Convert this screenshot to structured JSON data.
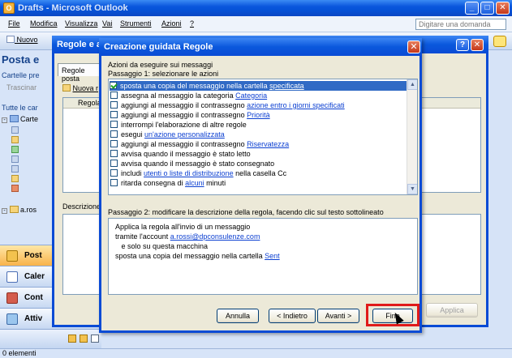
{
  "outlook": {
    "title": "Drafts - Microsoft Outlook",
    "menu": [
      "File",
      "Modifica",
      "Visualizza",
      "Vai",
      "Strumenti",
      "Azioni",
      "?"
    ],
    "help_placeholder": "Digitare una domanda",
    "toolbar_new": "Nuovo",
    "nav_header": "Posta e",
    "cartelle_label": "Cartelle pre",
    "trascina": "Trascinar",
    "tutte_label": "Tutte le car",
    "tree_root": "Carte",
    "tree_account": "a.ros",
    "nav_buttons": [
      {
        "label": "Post",
        "icon": "mail-icon"
      },
      {
        "label": "Caler",
        "icon": "calendar-icon"
      },
      {
        "label": "Cont",
        "icon": "contacts-icon"
      },
      {
        "label": "Attiv",
        "icon": "tasks-icon"
      }
    ],
    "status": "0 elementi"
  },
  "regole": {
    "title": "Regole e av",
    "tab_label": "Regole posta",
    "new_rule_btn": "Nuova r",
    "col_regola": "Regola",
    "desc_label": "Descrizione r",
    "apply_btn": "Applica"
  },
  "wizard": {
    "title": "Creazione guidata Regole",
    "heading": "Azioni da eseguire sui messaggi",
    "step1": "Passaggio 1: selezionare le azioni",
    "actions": [
      {
        "text": "sposta una copia del messaggio nella cartella ",
        "link": "specificata",
        "after": "",
        "checked": true,
        "selected": true
      },
      {
        "text": "assegna al messaggio la categoria ",
        "link": "Categoria",
        "after": "",
        "checked": false,
        "selected": false
      },
      {
        "text": "aggiungi al messaggio il contrassegno ",
        "link": "azione entro i giorni specificati",
        "after": "",
        "checked": false,
        "selected": false
      },
      {
        "text": "aggiungi al messaggio il contrassegno ",
        "link": "Priorità",
        "after": "",
        "checked": false,
        "selected": false
      },
      {
        "text": "interrompi l'elaborazione di altre regole",
        "link": "",
        "after": "",
        "checked": false,
        "selected": false
      },
      {
        "text": "esegui ",
        "link": "un'azione personalizzata",
        "after": "",
        "checked": false,
        "selected": false
      },
      {
        "text": "aggiungi al messaggio il contrassegno ",
        "link": "Riservatezza",
        "after": "",
        "checked": false,
        "selected": false
      },
      {
        "text": "avvisa quando il messaggio è stato letto",
        "link": "",
        "after": "",
        "checked": false,
        "selected": false
      },
      {
        "text": "avvisa quando il messaggio è stato consegnato",
        "link": "",
        "after": "",
        "checked": false,
        "selected": false
      },
      {
        "text": "includi ",
        "link": "utenti o liste di distribuzione",
        "after": " nella casella Cc",
        "checked": false,
        "selected": false
      },
      {
        "text": "ritarda consegna di ",
        "link": "alcuni",
        "after": " minuti",
        "checked": false,
        "selected": false
      }
    ],
    "step2": "Passaggio 2: modificare la descrizione della regola, facendo clic sul testo sottolineato",
    "description": [
      {
        "text": "Applica la regola all'invio di un messaggio",
        "link": ""
      },
      {
        "text": "tramite l'account ",
        "link": "a.rossi@dpconsulenze.com"
      },
      {
        "text": "   e solo su questa macchina",
        "link": ""
      },
      {
        "text": "sposta una copia del messaggio nella cartella ",
        "link": "Sent"
      }
    ],
    "buttons": {
      "cancel": "Annulla",
      "back": "< Indietro",
      "next": "Avanti >",
      "finish": "Fine"
    }
  }
}
